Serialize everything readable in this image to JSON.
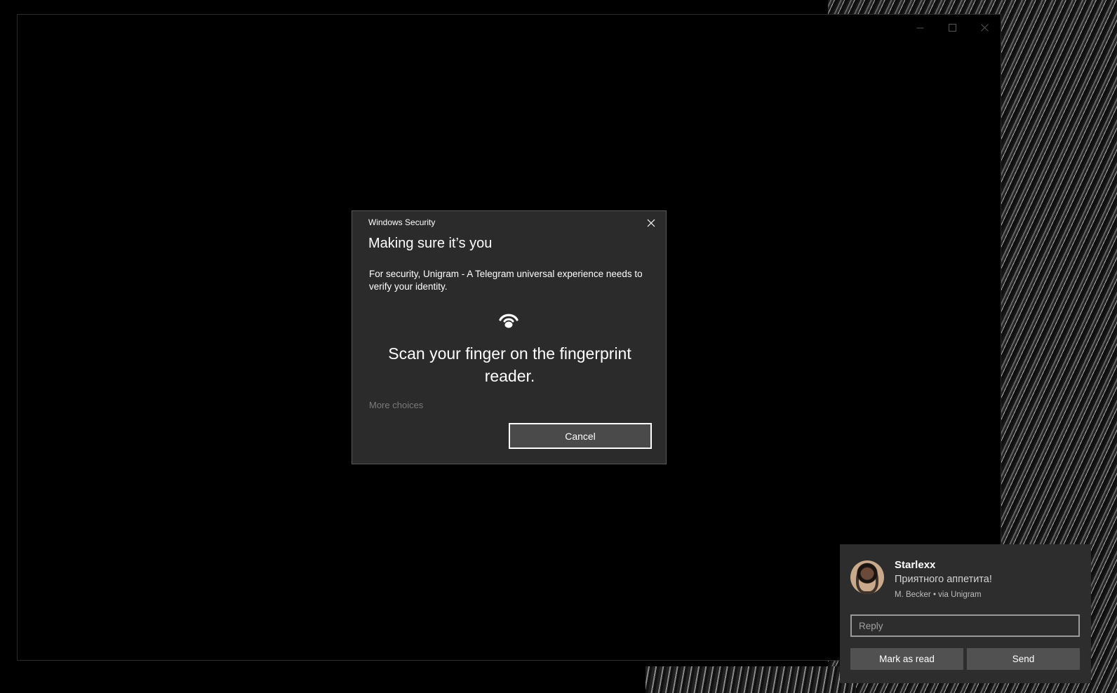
{
  "window": {
    "controls": [
      "minimize-icon",
      "maximize-icon",
      "close-icon"
    ]
  },
  "dialog": {
    "app_title": "Windows Security",
    "heading": "Making sure it’s you",
    "body": "For security, Unigram - A Telegram universal experience needs to verify your identity.",
    "icon": "fingerprint-icon",
    "scan_text": "Scan your finger on the fingerprint reader.",
    "more_choices": "More choices",
    "cancel_label": "Cancel"
  },
  "toast": {
    "sender": "Starlexx",
    "message": "Приятного аппетита!",
    "attribution": "M. Becker • via Unigram",
    "reply_placeholder": "Reply",
    "reply_value": "",
    "mark_read_label": "Mark as read",
    "send_label": "Send"
  },
  "colors": {
    "dialog_bg": "#2b2b2b",
    "toast_bg": "#2d2d2d",
    "button_bg": "#4a4a4a",
    "muted_text": "#7a7a7a"
  }
}
